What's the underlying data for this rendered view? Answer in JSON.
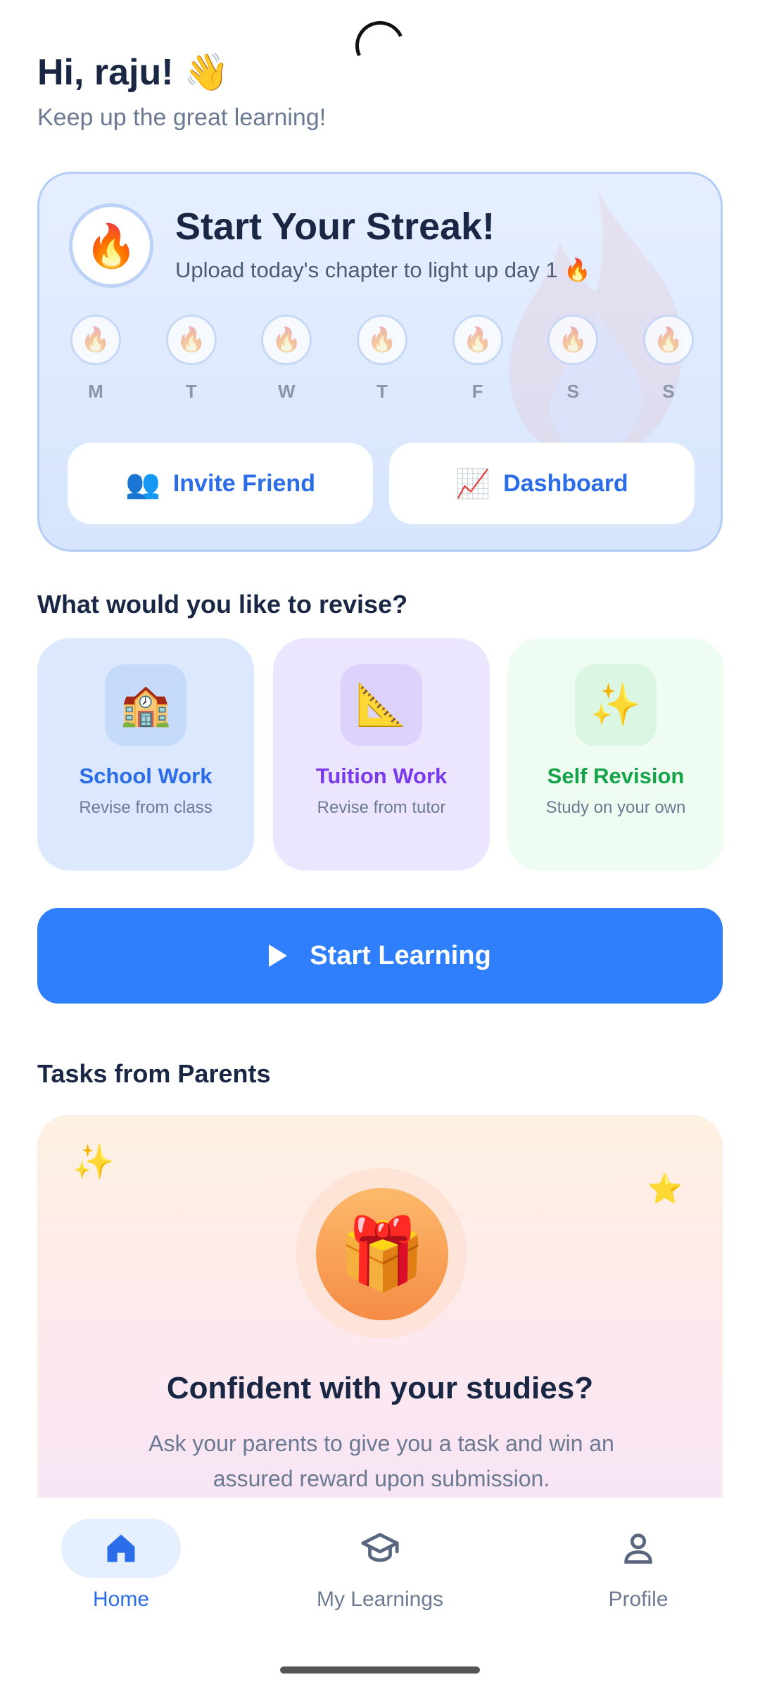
{
  "header": {
    "greeting": "Hi, raju! 👋",
    "subtitle": "Keep up the great learning!"
  },
  "streak": {
    "icon": "🔥",
    "title": "Start Your Streak!",
    "subtitle": "Upload today's chapter to light up day 1 🔥",
    "days": [
      "M",
      "T",
      "W",
      "T",
      "F",
      "S",
      "S"
    ],
    "day_icon": "🔥",
    "invite": {
      "icon": "👥",
      "label": "Invite Friend"
    },
    "dashboard": {
      "icon": "📈",
      "label": "Dashboard"
    }
  },
  "revise": {
    "title": "What would you like to revise?",
    "options": [
      {
        "icon": "🏫",
        "name": "School Work",
        "desc": "Revise from class"
      },
      {
        "icon": "📐",
        "name": "Tuition Work",
        "desc": "Revise from tutor"
      },
      {
        "icon": "✨",
        "name": "Self Revision",
        "desc": "Study on your own"
      }
    ]
  },
  "start_button": {
    "label": "Start Learning"
  },
  "tasks": {
    "title": "Tasks from Parents",
    "sparkle": "✨",
    "star": "⭐",
    "gift": "🎁",
    "card_title": "Confident with your studies?",
    "card_desc": "Ask your parents to give you a task and win an assured reward upon submission."
  },
  "nav": {
    "items": [
      {
        "label": "Home",
        "icon": "home-icon",
        "active": true
      },
      {
        "label": "My Learnings",
        "icon": "graduation-cap-icon",
        "active": false
      },
      {
        "label": "Profile",
        "icon": "person-icon",
        "active": false
      }
    ]
  },
  "colors": {
    "accent": "#2f7ffc",
    "school": "#2b6de8",
    "tuition": "#7c3aed",
    "self": "#16a34a"
  }
}
